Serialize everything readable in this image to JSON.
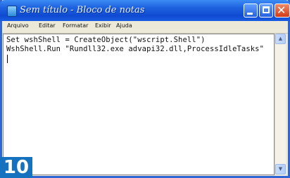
{
  "window": {
    "title": "Sem título - Bloco de notas"
  },
  "menu": {
    "items": [
      "Arquivo",
      "Editar",
      "Formatar",
      "Exibir",
      "Ajuda"
    ]
  },
  "editor": {
    "lines": [
      "Set wshShell = CreateObject(\"wscript.Shell\")",
      "WshShell.Run \"Rundll32.exe advapi32.dll,ProcessIdleTasks\""
    ]
  },
  "badge": {
    "step": "10"
  },
  "icons": {
    "app": "notepad-icon",
    "minimize": "minimize-icon",
    "maximize": "maximize-icon",
    "close": "close-icon",
    "scroll_up": "arrow-up-icon",
    "scroll_down": "arrow-down-icon"
  },
  "colors": {
    "titlebar": "#0e4ad1",
    "close_button": "#d23c18",
    "badge": "#1672bf",
    "frame": "#ece9d8"
  }
}
